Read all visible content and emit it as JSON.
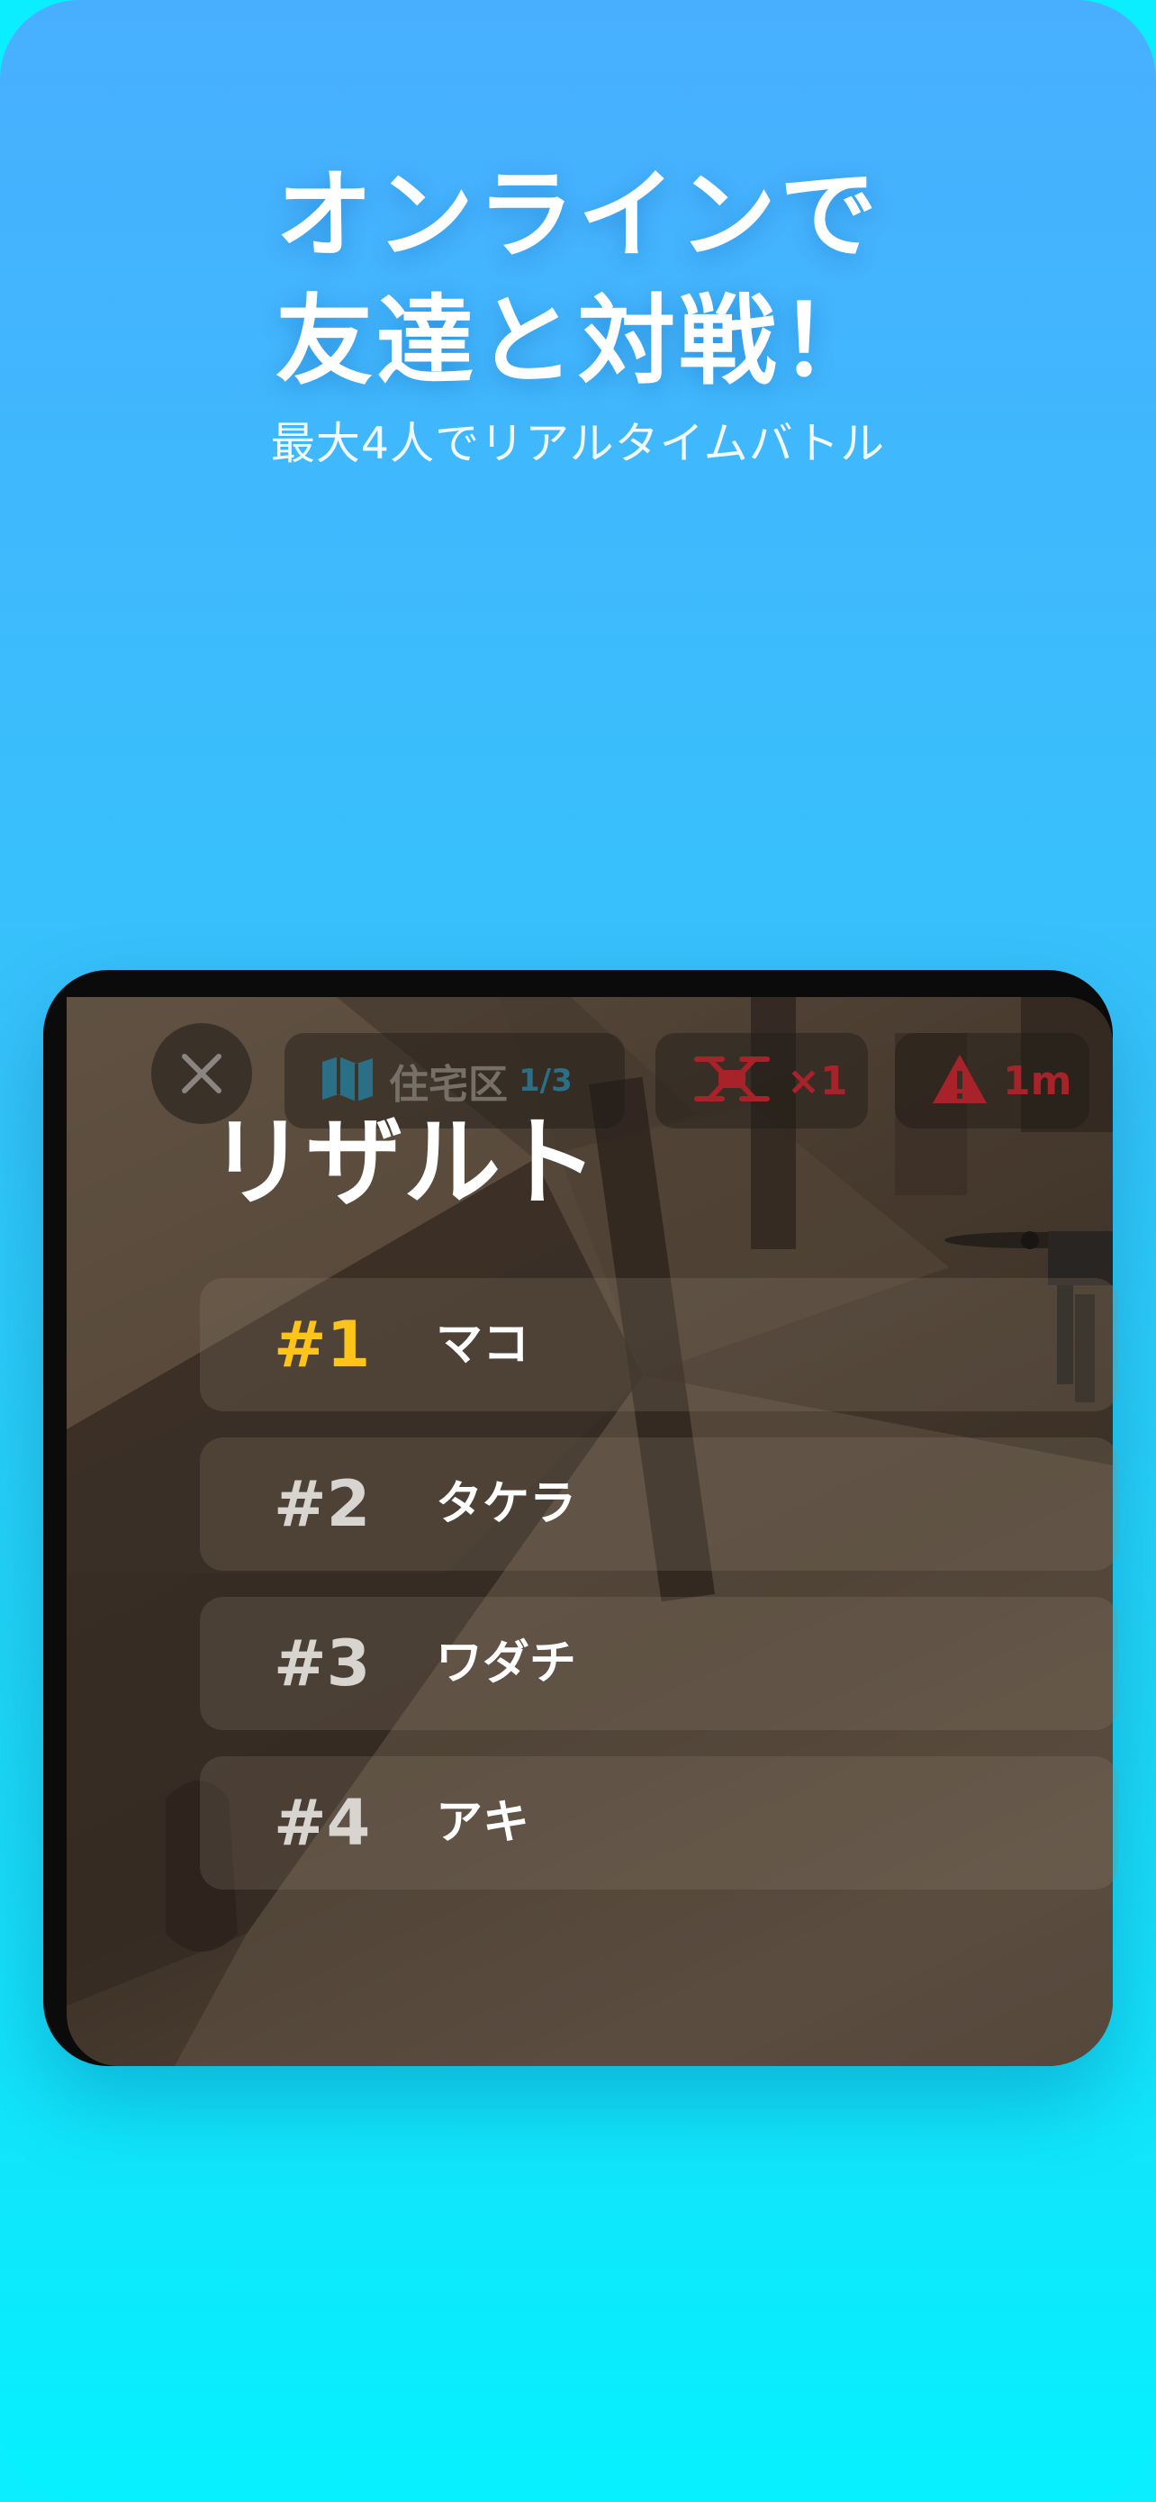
{
  "hero": {
    "title_line1": "オンラインで",
    "title_line2": "友達と対戦！",
    "subtitle": "最大4人でリアルタイムバトル"
  },
  "game": {
    "hud": {
      "close_icon": "close-icon",
      "map": {
        "icon": "map-icon",
        "label": "住宅区",
        "progress": "1/3"
      },
      "drone": {
        "icon": "drone-icon",
        "count": "×1"
      },
      "warning": {
        "icon": "warning-icon",
        "distance": "1m"
      }
    },
    "result": {
      "title": "リザルト",
      "rankings": [
        {
          "rank": "#1",
          "name": "マコ"
        },
        {
          "rank": "#2",
          "name": "タケラ"
        },
        {
          "rank": "#3",
          "name": "ワダチ"
        },
        {
          "rank": "#4",
          "name": "アキ"
        }
      ]
    }
  },
  "colors": {
    "gradient_top": "#48afff",
    "gradient_bottom": "#05f1ff",
    "first_place": "#ffc41a",
    "alert_red": "#a8222a"
  }
}
